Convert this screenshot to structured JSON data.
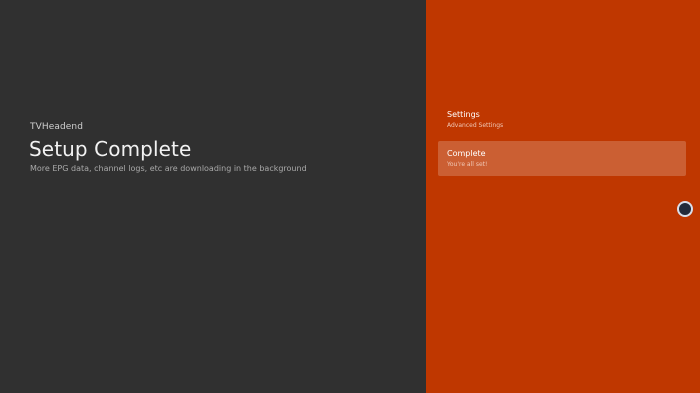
{
  "guidance": {
    "breadcrumb": "TVHeadend",
    "title": "Setup Complete",
    "description": "More EPG data, channel logs, etc are downloading in the background"
  },
  "actions": [
    {
      "label": "Settings",
      "sublabel": "Advanced Settings"
    },
    {
      "label": "Complete",
      "sublabel": "You're all set!"
    }
  ],
  "colors": {
    "left_background": "#303030",
    "right_background": "#bf3700",
    "highlight": "rgba(255,255,255,0.2)"
  }
}
